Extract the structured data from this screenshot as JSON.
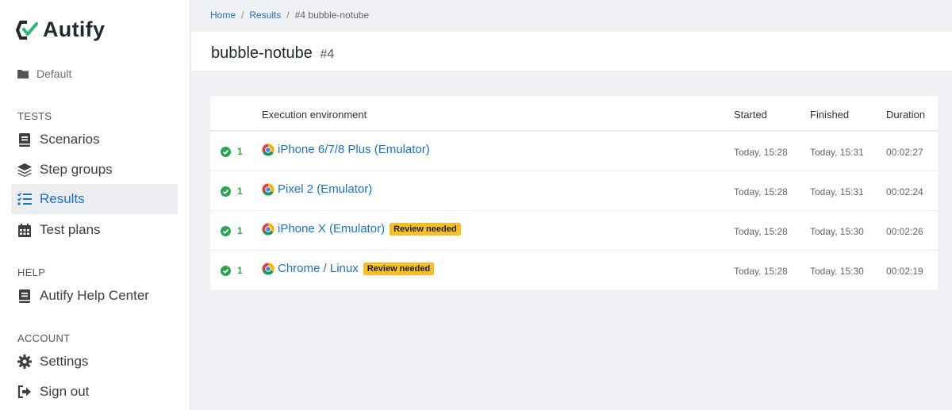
{
  "app": {
    "logo_text": "Autify"
  },
  "sidebar": {
    "workspace": "Default",
    "sections": [
      {
        "label": "TESTS",
        "items": [
          {
            "label": "Scenarios",
            "icon": "book-icon"
          },
          {
            "label": "Step groups",
            "icon": "layers-icon"
          },
          {
            "label": "Results",
            "icon": "checklist-icon",
            "active": true
          },
          {
            "label": "Test plans",
            "icon": "calendar-icon"
          }
        ]
      },
      {
        "label": "HELP",
        "items": [
          {
            "label": "Autify Help Center",
            "icon": "book-icon"
          }
        ]
      },
      {
        "label": "ACCOUNT",
        "items": [
          {
            "label": "Settings",
            "icon": "gear-icon"
          },
          {
            "label": "Sign out",
            "icon": "sign-out-icon"
          }
        ]
      }
    ]
  },
  "breadcrumb": {
    "home": "Home",
    "results": "Results",
    "current": "#4 bubble-notube",
    "separator": "/"
  },
  "page": {
    "title": "bubble-notube",
    "number": "#4"
  },
  "table": {
    "headers": {
      "environment": "Execution environment",
      "started": "Started",
      "finished": "Finished",
      "duration": "Duration"
    },
    "rows": [
      {
        "status_count": "1",
        "environment": "iPhone 6/7/8 Plus (Emulator)",
        "badge": "",
        "started": "Today, 15:28",
        "finished": "Today, 15:31",
        "duration": "00:02:27"
      },
      {
        "status_count": "1",
        "environment": "Pixel 2 (Emulator)",
        "badge": "",
        "started": "Today, 15:28",
        "finished": "Today, 15:31",
        "duration": "00:02:24"
      },
      {
        "status_count": "1",
        "environment": "iPhone X (Emulator)",
        "badge": "Review needed",
        "started": "Today, 15:28",
        "finished": "Today, 15:30",
        "duration": "00:02:26"
      },
      {
        "status_count": "1",
        "environment": "Chrome / Linux",
        "badge": "Review needed",
        "started": "Today, 15:28",
        "finished": "Today, 15:30",
        "duration": "00:02:19"
      }
    ]
  },
  "colors": {
    "accent": "#1a73c9",
    "success": "#2aa44f",
    "badge": "#f6bf26"
  }
}
